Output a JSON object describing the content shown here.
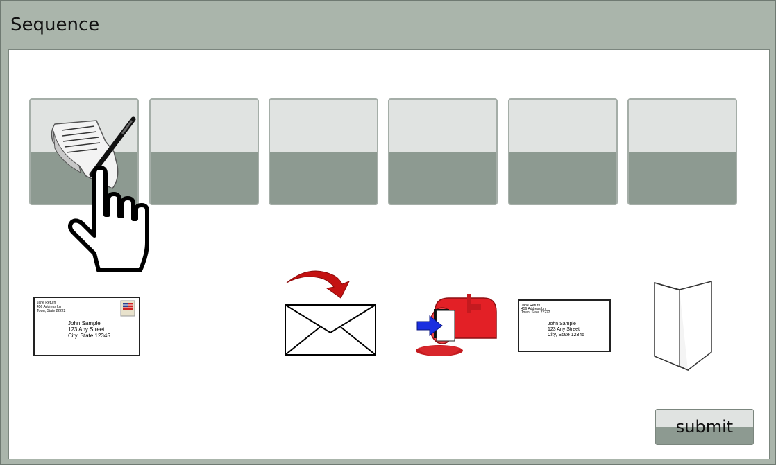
{
  "window": {
    "title": "Sequence"
  },
  "slots": [
    {
      "label": "slot-1",
      "content": "writing-letter"
    },
    {
      "label": "slot-2",
      "content": ""
    },
    {
      "label": "slot-3",
      "content": ""
    },
    {
      "label": "slot-4",
      "content": ""
    },
    {
      "label": "slot-5",
      "content": ""
    },
    {
      "label": "slot-6",
      "content": ""
    }
  ],
  "cards": {
    "addressed_envelope_large": {
      "return_line1": "Jane Return",
      "return_line2": "456 Address Ln",
      "return_line3": "Town, State 22222",
      "recipient_line1": "John Sample",
      "recipient_line2": "123 Any Street",
      "recipient_line3": "City, State 12345"
    },
    "addressed_envelope_small": {
      "return_line1": "Jane Return",
      "return_line2": "456 Address Ln",
      "return_line3": "Town, State 22222",
      "recipient_line1": "John Sample",
      "recipient_line2": "123 Any Street",
      "recipient_line3": "City, State 12345"
    },
    "icons": [
      "stamp-icon",
      "insert-into-envelope-icon",
      "mailbox-icon",
      "folded-letter-icon",
      "pointing-hand-icon",
      "letter-and-pen-icon"
    ]
  },
  "submit": {
    "label": "submit"
  },
  "colors": {
    "frame_bg": "#aab5ab",
    "slot_top": "#e0e3e1",
    "slot_bottom": "#8d9a91",
    "mailbox_red": "#e32026",
    "arrow_blue": "#1b2fe0"
  }
}
